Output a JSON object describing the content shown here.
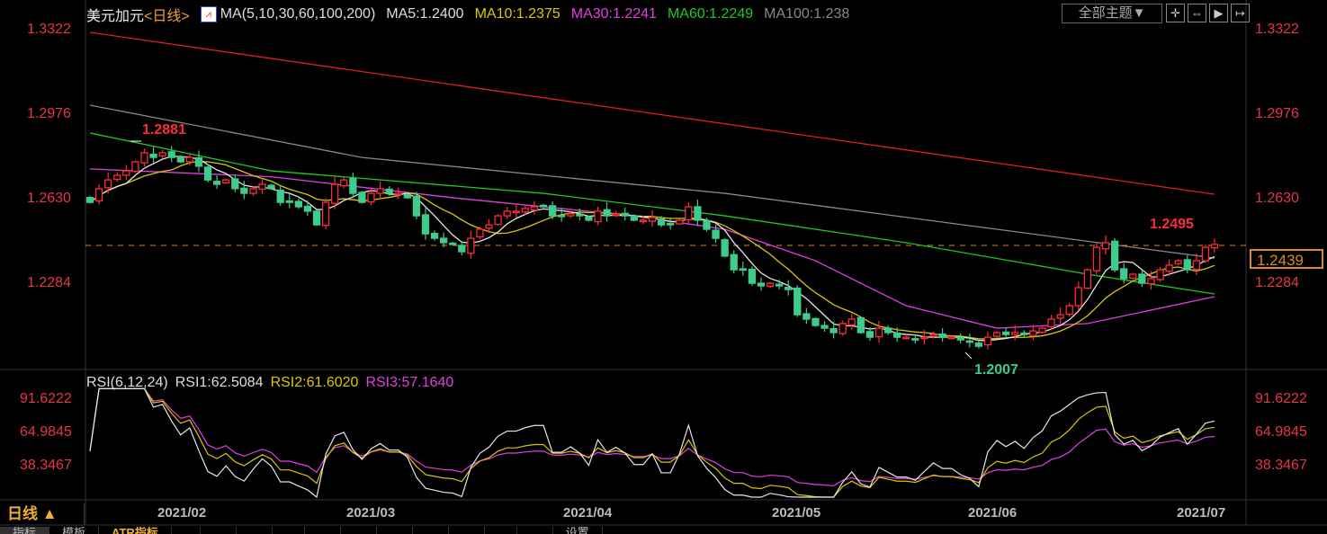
{
  "header": {
    "symbol": "美元加元",
    "period": "<日线>",
    "ma_label": "MA(5,10,30,60,100,200)",
    "ma5": "MA5:1.2400",
    "ma10": "MA10:1.2375",
    "ma30": "MA30:1.2241",
    "ma60": "MA60:1.2249",
    "ma100": "MA100:1.238",
    "theme_button": "全部主题▼",
    "tools": [
      "crosshair-icon",
      "zoom-in-icon",
      "play-icon",
      "exit-icon"
    ]
  },
  "rsi_header": {
    "label": "RSI(6,12,24)",
    "rsi1": "RSI1:62.5084",
    "rsi2": "RSI2:61.6020",
    "rsi3": "RSI3:57.1640"
  },
  "price_axis": [
    "1.3322",
    "1.2976",
    "1.2630",
    "1.2284"
  ],
  "rsi_axis": [
    "91.6222",
    "64.9845",
    "38.3467"
  ],
  "current_price": "1.2439",
  "annotations": {
    "high": "1.2881",
    "recent_high": "1.2495",
    "low": "1.2007"
  },
  "dates": [
    "2021/02",
    "2021/03",
    "2021/04",
    "2021/05",
    "2021/06",
    "2021/07"
  ],
  "period_selector": "日线 ▲",
  "bottom_tabs": [
    "指标",
    "模板",
    "ATR指标",
    "",
    "",
    "",
    "",
    "",
    "",
    "",
    "",
    "",
    "",
    "",
    "",
    "设置"
  ],
  "colors": {
    "up": "#ff2a3a",
    "down": "#3ecb8c",
    "ma5": "#e6e6e6",
    "ma10": "#d8c800",
    "ma30": "#e040e0",
    "ma60": "#1fc81f",
    "ma100": "#888888",
    "ma200": "#e02020",
    "axis": "#e8334a",
    "current": "#d98a22"
  },
  "chart_data": {
    "type": "candlestick",
    "title": "美元加元 日线",
    "ylim": [
      1.195,
      1.3322
    ],
    "closes": [
      1.2615,
      1.2671,
      1.2707,
      1.2726,
      1.2744,
      1.2781,
      1.2818,
      1.2799,
      1.2818,
      1.2799,
      1.2781,
      1.2799,
      1.2763,
      1.2707,
      1.2689,
      1.2707,
      1.2671,
      1.2652,
      1.2671,
      1.2689,
      1.2671,
      1.2615,
      1.2615,
      1.2597,
      1.2579,
      1.2523,
      1.2615,
      1.2689,
      1.2707,
      1.2652,
      1.2615,
      1.2652,
      1.2671,
      1.2652,
      1.2652,
      1.2634,
      1.256,
      1.2486,
      1.2468,
      1.245,
      1.2443,
      1.2413,
      1.2468,
      1.2505,
      1.2523,
      1.256,
      1.2579,
      1.2579,
      1.259,
      1.2597,
      1.2597,
      1.256,
      1.256,
      1.2568,
      1.256,
      1.2542,
      1.2579,
      1.256,
      1.2568,
      1.256,
      1.2542,
      1.2542,
      1.2553,
      1.2523,
      1.2523,
      1.2542,
      1.2597,
      1.2542,
      1.2505,
      1.2468,
      1.2395,
      1.2339,
      1.2339,
      1.2284,
      1.2273,
      1.2284,
      1.2273,
      1.2258,
      1.2155,
      1.2137,
      1.2111,
      1.21,
      1.2082,
      1.2119,
      1.2137,
      1.2082,
      1.2063,
      1.21,
      1.2082,
      1.2063,
      1.2063,
      1.2052,
      1.2063,
      1.2074,
      1.2063,
      1.2063,
      1.2052,
      1.2045,
      1.2026,
      1.2063,
      1.2082,
      1.2074,
      1.2082,
      1.2074,
      1.2089,
      1.21,
      1.2137,
      1.2155,
      1.2192,
      1.2266,
      1.2339,
      1.2431,
      1.245,
      1.2339,
      1.2303,
      1.2321,
      1.2284,
      1.2303,
      1.2339,
      1.2358,
      1.2376,
      1.2339,
      1.2376,
      1.2431,
      1.2443
    ],
    "ma_lines": {
      "ma30": [
        [
          0,
          1.2752
        ],
        [
          20,
          1.272
        ],
        [
          40,
          1.2634
        ],
        [
          60,
          1.256
        ],
        [
          70,
          1.2505
        ],
        [
          80,
          1.2376
        ],
        [
          90,
          1.2192
        ],
        [
          100,
          1.21
        ],
        [
          110,
          1.2119
        ],
        [
          124,
          1.2229
        ]
      ],
      "ma60": [
        [
          0,
          1.2899
        ],
        [
          20,
          1.2744
        ],
        [
          50,
          1.2652
        ],
        [
          70,
          1.256
        ],
        [
          90,
          1.245
        ],
        [
          110,
          1.2321
        ],
        [
          124,
          1.224
        ]
      ],
      "ma100": [
        [
          0,
          1.3013
        ],
        [
          30,
          1.2799
        ],
        [
          70,
          1.2652
        ],
        [
          100,
          1.2505
        ],
        [
          124,
          1.2387
        ]
      ],
      "ma200": [
        [
          0,
          1.3311
        ],
        [
          60,
          1.299
        ],
        [
          124,
          1.2648
        ]
      ]
    },
    "rsi_periods": [
      6,
      12,
      24
    ],
    "rsi_ylim": [
      0,
      100
    ]
  }
}
